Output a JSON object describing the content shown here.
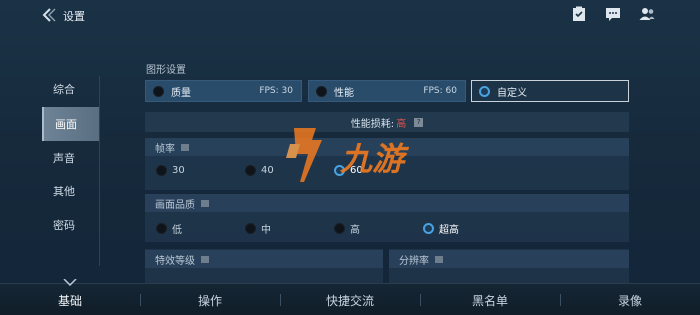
{
  "header": {
    "title": "设置",
    "icons": [
      "back-arrow-icon",
      "checklist-icon",
      "chat-icon",
      "friends-icon"
    ]
  },
  "sidebar": {
    "items": [
      {
        "label": "综合"
      },
      {
        "label": "画面",
        "active": true
      },
      {
        "label": "声音"
      },
      {
        "label": "其他"
      },
      {
        "label": "密码"
      }
    ]
  },
  "graphics": {
    "section_label": "图形设置",
    "modes": [
      {
        "label": "质量",
        "fps": "FPS: 30"
      },
      {
        "label": "性能",
        "fps": "FPS: 60"
      },
      {
        "label": "自定义",
        "selected": true
      }
    ],
    "perf_label": "性能损耗:",
    "perf_value": "高",
    "perf_help": "?"
  },
  "framerate": {
    "label": "帧率",
    "options": [
      {
        "label": "30"
      },
      {
        "label": "40"
      },
      {
        "label": "60",
        "selected": true
      }
    ]
  },
  "quality": {
    "label": "画面品质",
    "options": [
      {
        "label": "低"
      },
      {
        "label": "中"
      },
      {
        "label": "高"
      },
      {
        "label": "超高",
        "selected": true
      }
    ]
  },
  "effects": {
    "label": "特效等级"
  },
  "resolution": {
    "label": "分辨率"
  },
  "watermark": {
    "text": "九游"
  },
  "bottom_tabs": [
    {
      "label": "基础",
      "active": true
    },
    {
      "label": "操作"
    },
    {
      "label": "快捷交流"
    },
    {
      "label": "黑名单"
    },
    {
      "label": "录像"
    }
  ],
  "colors": {
    "accent": "#4aa2e0",
    "warning": "#e5534b",
    "watermark_orange": "#f07a1f"
  }
}
